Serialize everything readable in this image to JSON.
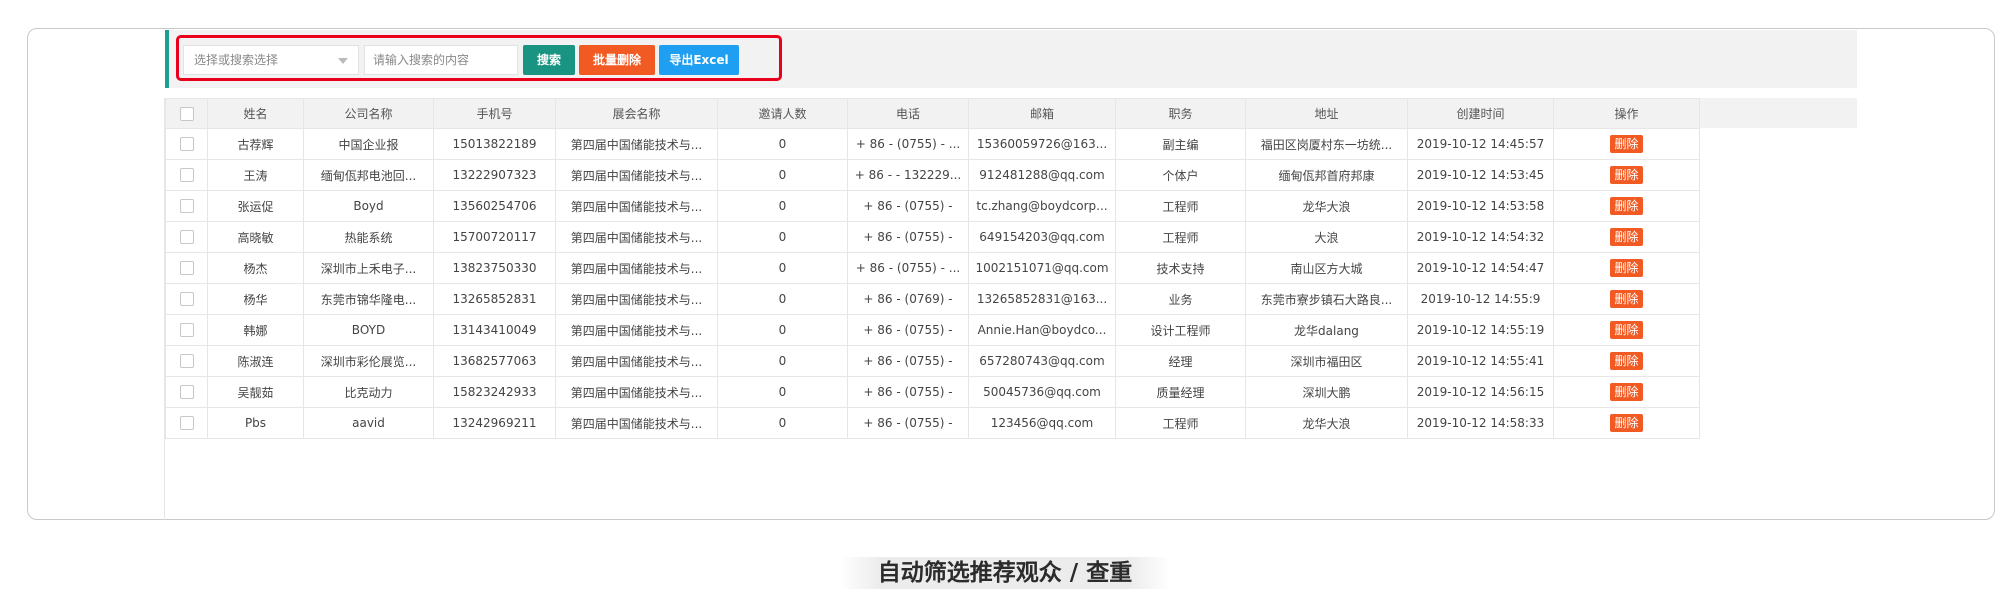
{
  "toolbar": {
    "select_placeholder": "选择或搜索选择",
    "search_placeholder": "请输入搜索的内容",
    "search_label": "搜索",
    "batch_delete_label": "批量删除",
    "export_label": "导出Excel"
  },
  "table": {
    "headers": [
      "姓名",
      "公司名称",
      "手机号",
      "展会名称",
      "邀请人数",
      "电话",
      "邮箱",
      "职务",
      "地址",
      "创建时间",
      "操作"
    ],
    "delete_label": "删除",
    "rows": [
      {
        "name": "古荐辉",
        "company": "中国企业报",
        "mobile": "15013822189",
        "expo": "第四届中国储能技术与...",
        "invites": "0",
        "phone": "+ 86 - (0755) - ...",
        "email": "15360059726@163...",
        "title": "副主编",
        "address": "福田区岗厦村东一坊统...",
        "created": "2019-10-12 14:45:57"
      },
      {
        "name": "王涛",
        "company": "缅甸佤邦电池回...",
        "mobile": "13222907323",
        "expo": "第四届中国储能技术与...",
        "invites": "0",
        "phone": "+ 86 - - 132229...",
        "email": "912481288@qq.com",
        "title": "个体户",
        "address": "缅甸佤邦首府邦康",
        "created": "2019-10-12 14:53:45"
      },
      {
        "name": "张运促",
        "company": "Boyd",
        "mobile": "13560254706",
        "expo": "第四届中国储能技术与...",
        "invites": "0",
        "phone": "+ 86 - (0755) -",
        "email": "tc.zhang@boydcorp...",
        "title": "工程师",
        "address": "龙华大浪",
        "created": "2019-10-12 14:53:58"
      },
      {
        "name": "高晓敏",
        "company": "热能系统",
        "mobile": "15700720117",
        "expo": "第四届中国储能技术与...",
        "invites": "0",
        "phone": "+ 86 - (0755) -",
        "email": "649154203@qq.com",
        "title": "工程师",
        "address": "大浪",
        "created": "2019-10-12 14:54:32"
      },
      {
        "name": "杨杰",
        "company": "深圳市上禾电子...",
        "mobile": "13823750330",
        "expo": "第四届中国储能技术与...",
        "invites": "0",
        "phone": "+ 86 - (0755) - ...",
        "email": "1002151071@qq.com",
        "title": "技术支持",
        "address": "南山区方大城",
        "created": "2019-10-12 14:54:47"
      },
      {
        "name": "杨华",
        "company": "东莞市锦华隆电...",
        "mobile": "13265852831",
        "expo": "第四届中国储能技术与...",
        "invites": "0",
        "phone": "+ 86 - (0769) -",
        "email": "13265852831@163...",
        "title": "业务",
        "address": "东莞市寮步镇石大路良...",
        "created": "2019-10-12 14:55:9"
      },
      {
        "name": "韩娜",
        "company": "BOYD",
        "mobile": "13143410049",
        "expo": "第四届中国储能技术与...",
        "invites": "0",
        "phone": "+ 86 - (0755) -",
        "email": "Annie.Han@boydco...",
        "title": "设计工程师",
        "address": "龙华dalang",
        "created": "2019-10-12 14:55:19"
      },
      {
        "name": "陈淑连",
        "company": "深圳市彩伦展览...",
        "mobile": "13682577063",
        "expo": "第四届中国储能技术与...",
        "invites": "0",
        "phone": "+ 86 - (0755) -",
        "email": "657280743@qq.com",
        "title": "经理",
        "address": "深圳市福田区",
        "created": "2019-10-12 14:55:41"
      },
      {
        "name": "吴靓茹",
        "company": "比克动力",
        "mobile": "15823242933",
        "expo": "第四届中国储能技术与...",
        "invites": "0",
        "phone": "+ 86 - (0755) -",
        "email": "50045736@qq.com",
        "title": "质量经理",
        "address": "深圳大鹏",
        "created": "2019-10-12 14:56:15"
      },
      {
        "name": "Pbs",
        "company": "aavid",
        "mobile": "13242969211",
        "expo": "第四届中国储能技术与...",
        "invites": "0",
        "phone": "+ 86 - (0755) -",
        "email": "123456@qq.com",
        "title": "工程师",
        "address": "龙华大浪",
        "created": "2019-10-12 14:58:33"
      }
    ]
  },
  "caption": "自动筛选推荐观众 / 查重",
  "colors": {
    "accent_teal": "#1a9482",
    "danger_orange": "#f25a23",
    "export_blue": "#1e9ff2",
    "highlight_red": "#e8001c"
  }
}
